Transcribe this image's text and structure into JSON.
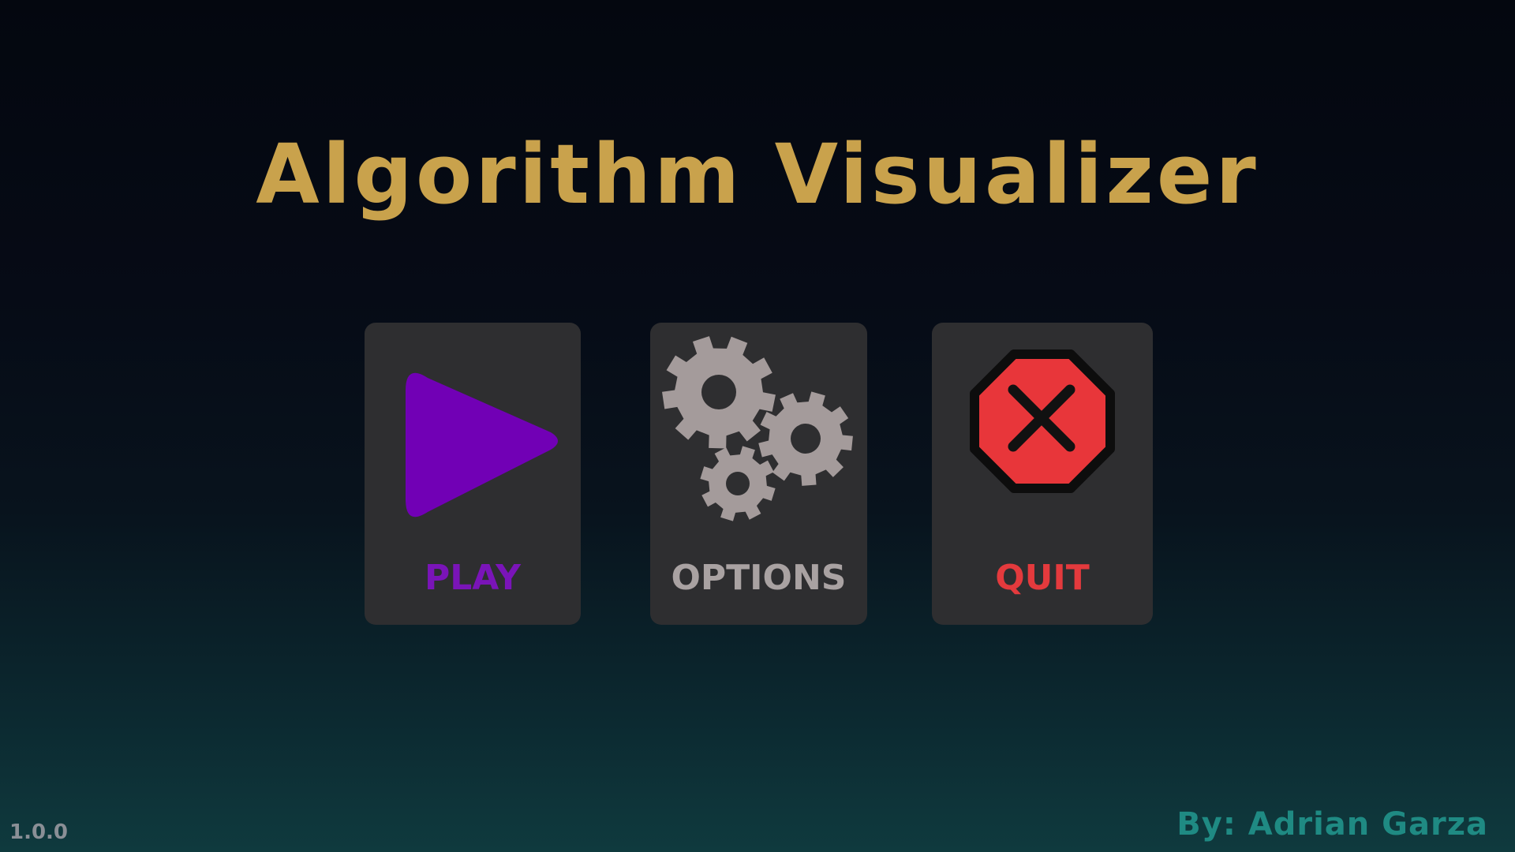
{
  "app": {
    "title": "Algorithm Visualizer"
  },
  "menu": {
    "play": {
      "label": "PLAY",
      "icon": "play-icon",
      "color": "#7a14b8"
    },
    "options": {
      "label": "OPTIONS",
      "icon": "gears-icon",
      "color": "#a9a2a2"
    },
    "quit": {
      "label": "QUIT",
      "icon": "stop-sign-x-icon",
      "color": "#e43a3d"
    }
  },
  "footer": {
    "version": "1.0.0",
    "credit": "By: Adrian Garza"
  },
  "colors": {
    "title": "#c9a24c",
    "card_background": "#2e2e30",
    "credit": "#1f8a83"
  }
}
